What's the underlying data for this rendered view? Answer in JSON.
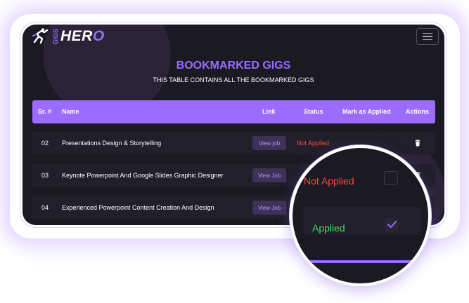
{
  "brand": {
    "logo_small": "GIGS",
    "logo_main_1": "HER",
    "logo_main_2": "O"
  },
  "page": {
    "title": "BOOKMARKED GIGS",
    "subtitle": "THIS TABLE CONTAINS ALL THE BOOKMARKED GIGS"
  },
  "table": {
    "headers": {
      "sr": "Sr. #",
      "name": "Name",
      "link": "Link",
      "status": "Status",
      "mark": "Mark as Applied",
      "actions": "Actions"
    },
    "rows": [
      {
        "sr": "02",
        "name": "Presentations Design & Storytelling",
        "link": "View job",
        "status": "Not Applied"
      },
      {
        "sr": "03",
        "name": "Keynote Powerpoint And Google Slides Graphic Designer",
        "link": "View Job",
        "status": ""
      },
      {
        "sr": "04",
        "name": "Experienced Powerpoint Content Creation And Design",
        "link": "View Job",
        "status": ""
      }
    ]
  },
  "magnifier": {
    "status_not_applied": "Not Applied",
    "status_applied": "Applied",
    "checked": true
  },
  "colors": {
    "accent": "#9b6cff",
    "not_applied": "#ff4747",
    "applied": "#3ee05a",
    "background": "#1b1a22"
  },
  "icons": {
    "menu": "hamburger-menu-icon",
    "delete": "trash-icon",
    "check": "checkmark-icon",
    "logo": "runner-logo-icon"
  }
}
